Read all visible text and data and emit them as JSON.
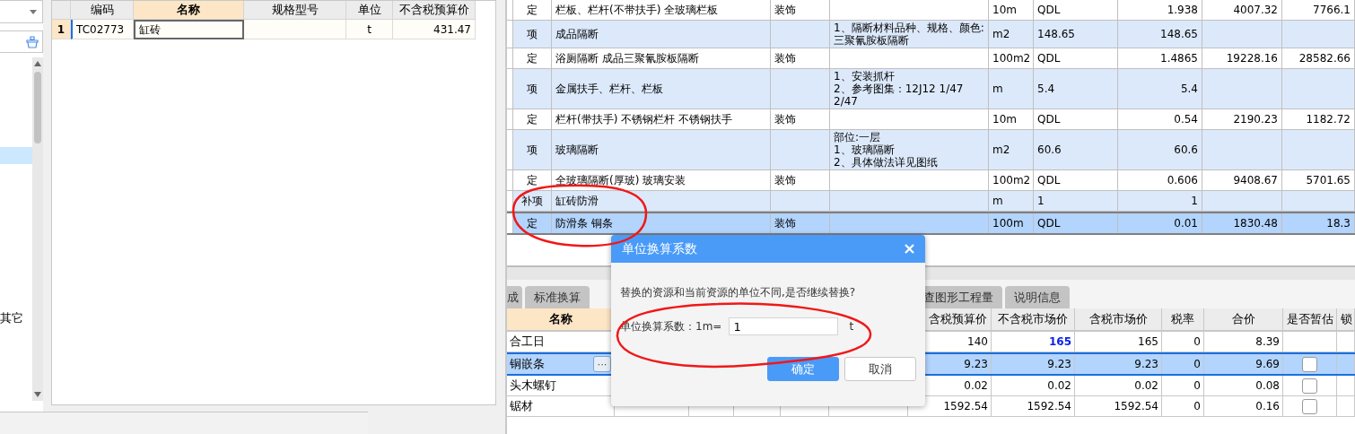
{
  "sidebar": {
    "items": [
      {
        "selected": true
      },
      {
        "label": "其它",
        "selected": false
      }
    ]
  },
  "resource_table": {
    "columns": [
      {
        "label": "编码",
        "selected": false
      },
      {
        "label": "名称",
        "selected": true
      },
      {
        "label": "规格型号",
        "selected": false
      },
      {
        "label": "单位",
        "selected": false
      },
      {
        "label": "不含税预算价",
        "selected": false
      }
    ],
    "rows": [
      {
        "index": "1",
        "code": "TC02773",
        "name": "缸砖",
        "unit": "t",
        "price": "431.47",
        "editing": true
      }
    ]
  },
  "bill_table": {
    "rows": [
      {
        "kind": "quota",
        "type": "定",
        "name": "栏板、栏杆(不带扶手) 全玻璃栏板",
        "major": "装饰",
        "unit": "10m",
        "expression": "QDL",
        "quantity": "1.938",
        "unit_price": "4007.32",
        "total": "7766.1",
        "selected": false
      },
      {
        "kind": "item",
        "type": "项",
        "name": "成品隔断",
        "features": [
          "1、隔断材料品种、规格、颜色:",
          "三聚氰胺板隔断"
        ],
        "unit": "m2",
        "expression": "148.65",
        "quantity": "148.65",
        "selected": false
      },
      {
        "kind": "quota",
        "type": "定",
        "name": "浴厕隔断 成品三聚氰胺板隔断",
        "major": "装饰",
        "unit": "100m2",
        "expression": "QDL",
        "quantity": "1.4865",
        "unit_price": "19228.16",
        "total": "28582.66",
        "selected": false
      },
      {
        "kind": "item",
        "type": "项",
        "name": "金属扶手、栏杆、栏板",
        "features": [
          "1、安装抓杆",
          "2、参考图集：12J12 1/47",
          "2/47"
        ],
        "unit": "m",
        "expression": "5.4",
        "quantity": "5.4",
        "selected": false
      },
      {
        "kind": "quota",
        "type": "定",
        "name": "栏杆(带扶手) 不锈钢栏杆 不锈钢扶手",
        "major": "装饰",
        "unit": "10m",
        "expression": "QDL",
        "quantity": "0.54",
        "unit_price": "2190.23",
        "total": "1182.72",
        "selected": false
      },
      {
        "kind": "item",
        "type": "项",
        "name": "玻璃隔断",
        "features": [
          "部位:一层",
          "1、玻璃隔断",
          "2、具体做法详见图纸"
        ],
        "unit": "m2",
        "expression": "60.6",
        "quantity": "60.6",
        "selected": false
      },
      {
        "kind": "quota",
        "type": "定",
        "name": "全玻璃隔断(厚玻) 玻璃安装",
        "major": "装饰",
        "unit": "100m2",
        "expression": "QDL",
        "quantity": "0.606",
        "unit_price": "9408.67",
        "total": "5701.65",
        "selected": false
      },
      {
        "kind": "item",
        "type": "补项",
        "name": "缸砖防滑",
        "unit": "m",
        "expression": "1",
        "quantity": "1",
        "selected": false
      },
      {
        "kind": "quota",
        "type": "定",
        "name": "防滑条 铜条",
        "major": "装饰",
        "unit": "100m",
        "expression": "QDL",
        "quantity": "0.01",
        "unit_price": "1830.48",
        "total": "18.3",
        "selected": true
      }
    ]
  },
  "tabs": [
    {
      "label": "成",
      "selected": false
    },
    {
      "label": "标准换算",
      "selected": false
    },
    {
      "label": "查图形工程量",
      "selected": false
    },
    {
      "label": "说明信息",
      "selected": false
    }
  ],
  "detail_table": {
    "columns": [
      {
        "label": "名称",
        "selected": true
      },
      {
        "label": "含税预算价",
        "selected": false
      },
      {
        "label": "不含税市场价",
        "selected": false
      },
      {
        "label": "含税市场价",
        "selected": false
      },
      {
        "label": "税率",
        "selected": false
      },
      {
        "label": "合价",
        "selected": false
      },
      {
        "label": "是否暂估",
        "selected": false
      },
      {
        "label": "锁",
        "selected": false
      }
    ],
    "rows": [
      {
        "name": "合工日",
        "values": [
          "140",
          "165",
          "165",
          "0",
          "8.39"
        ],
        "market_price_changed": true,
        "selected": false
      },
      {
        "name": "铜嵌条",
        "picker_label": "···",
        "values": [
          "9.23",
          "9.23",
          "9.23",
          "0",
          "9.69"
        ],
        "market_price_changed": false,
        "estimated": false,
        "selected": true
      },
      {
        "name": "头木螺钉",
        "values": [
          "0.02",
          "0.02",
          "0.02",
          "0",
          "0.08"
        ],
        "market_price_changed": false,
        "estimated": false,
        "selected": false
      },
      {
        "name": "锯材",
        "values": [
          "1592.54",
          "1592.54",
          "1592.54",
          "0",
          "0.16"
        ],
        "market_price_changed": false,
        "estimated": false,
        "selected": false
      }
    ]
  },
  "dialog": {
    "title": "单位换算系数",
    "message": "替换的资源和当前资源的单位不同,是否继续替换?",
    "field_label": "单位换算系数：1m=",
    "value": "1",
    "unit": "t",
    "buttons": [
      {
        "label": "确定",
        "kind": "primary"
      },
      {
        "label": "取消",
        "kind": "secondary"
      }
    ]
  }
}
